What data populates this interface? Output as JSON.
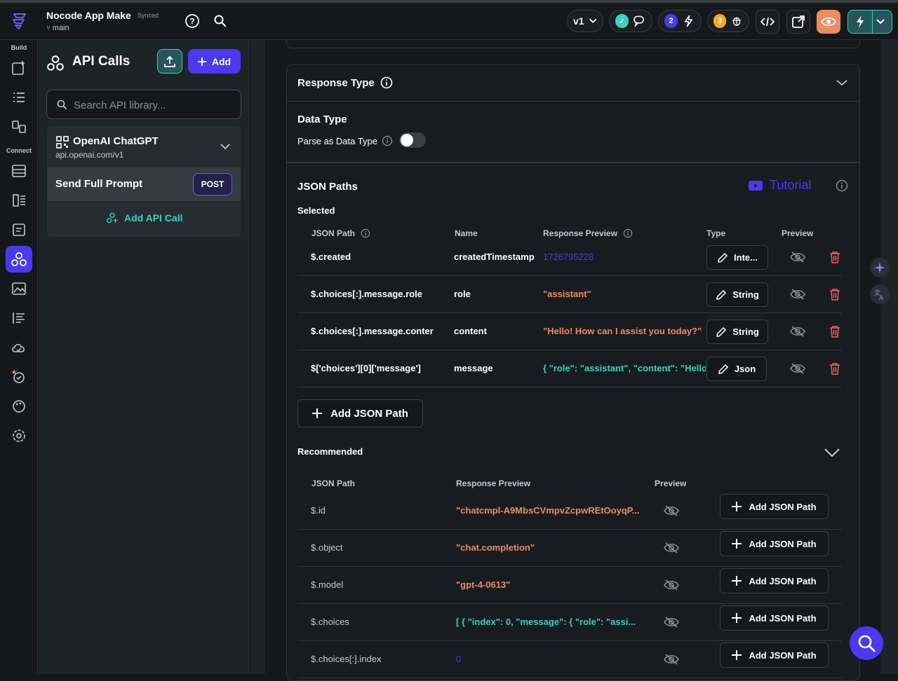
{
  "project": {
    "title": "Nocode App Make",
    "status": "Synced",
    "branch": "main"
  },
  "topbar": {
    "version": "v1",
    "notifications_count": "2",
    "bugs_count": "3"
  },
  "nav": {
    "section_build": "Build",
    "section_connect": "Connect"
  },
  "panel": {
    "title": "API Calls",
    "add_label": "Add",
    "search_placeholder": "Search API library...",
    "group": {
      "name": "OpenAI ChatGPT",
      "url": "api.openai.com/v1",
      "call_name": "Send Full Prompt",
      "call_method": "POST",
      "add_call_label": "Add API Call"
    }
  },
  "response_type": {
    "title": "Response Type",
    "data_type_title": "Data Type",
    "parse_label": "Parse as Data Type",
    "parse_enabled": false
  },
  "json_paths": {
    "title": "JSON Paths",
    "tutorial_label": "Tutorial",
    "selected_label": "Selected",
    "columns": {
      "path": "JSON Path",
      "name": "Name",
      "preview": "Response Preview",
      "type": "Type",
      "preview_toggle": "Preview"
    },
    "rows": [
      {
        "path": "$.created",
        "name": "createdTimestamp",
        "preview": "1726795228",
        "preview_color": "#4b39ef",
        "type": "Inte..."
      },
      {
        "path": "$.choices[:].message.role",
        "name": "role",
        "preview": "\"assistant\"",
        "preview_color": "#ee8b60",
        "type": "String"
      },
      {
        "path": "$.choices[:].message.conter",
        "name": "content",
        "preview": "\"Hello! How can I assist you today?\"",
        "preview_color": "#ee8b60",
        "type": "String"
      },
      {
        "path": "$['choices'][0]['message']",
        "name": "message",
        "preview": "{  \"role\": \"assistant\",  \"content\": \"Hello!...",
        "preview_color": "#39d2c0",
        "type": "Json"
      }
    ],
    "add_label": "Add JSON Path"
  },
  "recommended": {
    "title": "Recommended",
    "columns": {
      "path": "JSON Path",
      "preview": "Response Preview",
      "preview_toggle": "Preview"
    },
    "add_label": "Add JSON Path",
    "rows": [
      {
        "path": "$.id",
        "preview": "\"chatcmpl-A9MbsCVmpvZcpwREtOoyqP...",
        "preview_color": "#ee8b60"
      },
      {
        "path": "$.object",
        "preview": "\"chat.completion\"",
        "preview_color": "#ee8b60"
      },
      {
        "path": "$.model",
        "preview": "\"gpt-4-0613\"",
        "preview_color": "#ee8b60"
      },
      {
        "path": "$.choices",
        "preview": "[  {   \"index\": 0,   \"message\": {    \"role\": \"assi...",
        "preview_color": "#39d2c0"
      },
      {
        "path": "$.choices[:].index",
        "preview": "0",
        "preview_color": "#4b39ef"
      }
    ]
  },
  "colors": {
    "primary": "#4b39ef",
    "secondary": "#39d2c0",
    "tertiary": "#ee8b60",
    "error": "#ff5963",
    "warning": "#f9a825"
  }
}
